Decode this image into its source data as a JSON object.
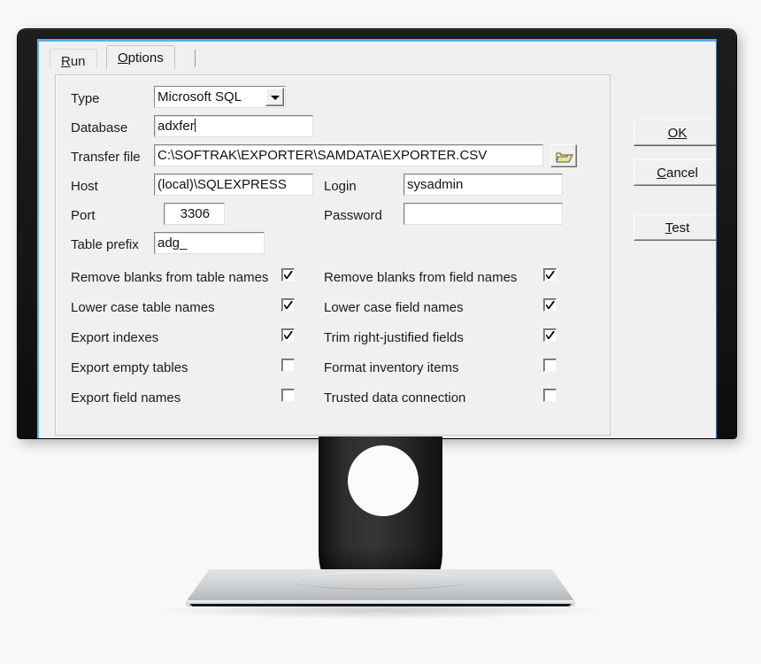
{
  "window": {
    "tabs": [
      {
        "label": "Run",
        "accel": "R",
        "active": false
      },
      {
        "label": "Options",
        "accel": "O",
        "active": true
      }
    ]
  },
  "form": {
    "fields": [
      {
        "name": "type",
        "label": "Type",
        "value": "Microsoft SQL",
        "control": "combobox"
      },
      {
        "name": "database",
        "label": "Database",
        "value": "adxfer",
        "control": "textbox",
        "focused": true
      },
      {
        "name": "transfer_file",
        "label": "Transfer file",
        "value": "C:\\SOFTRAK\\EXPORTER\\SAMDATA\\EXPORTER.CSV",
        "control": "textbox"
      },
      {
        "name": "host",
        "label": "Host",
        "value": "(local)\\SQLEXPRESS",
        "control": "textbox"
      },
      {
        "name": "login",
        "label": "Login",
        "value": "sysadmin",
        "control": "textbox"
      },
      {
        "name": "port",
        "label": "Port",
        "value": "3306",
        "control": "textbox",
        "align": "right"
      },
      {
        "name": "password",
        "label": "Password",
        "value": "",
        "control": "password"
      },
      {
        "name": "table_prefix",
        "label": "Table prefix",
        "value": "adg_",
        "control": "textbox"
      }
    ],
    "browse_icon": "open-folder-icon",
    "dropdown_icon": "chevron-down-icon"
  },
  "checkboxes": {
    "left": [
      {
        "name": "remove-blanks-table-names",
        "label": "Remove blanks from table names",
        "checked": true
      },
      {
        "name": "lower-case-table-names",
        "label": "Lower case table names",
        "checked": true
      },
      {
        "name": "export-indexes",
        "label": "Export indexes",
        "checked": true
      },
      {
        "name": "export-empty-tables",
        "label": "Export empty tables",
        "checked": false
      },
      {
        "name": "export-field-names",
        "label": "Export field names",
        "checked": false
      }
    ],
    "right": [
      {
        "name": "remove-blanks-field-names",
        "label": "Remove blanks from field names",
        "checked": true
      },
      {
        "name": "lower-case-field-names",
        "label": "Lower case field names",
        "checked": true
      },
      {
        "name": "trim-right-justified",
        "label": "Trim right-justified fields",
        "checked": true
      },
      {
        "name": "format-inventory-items",
        "label": "Format inventory items",
        "checked": false
      },
      {
        "name": "trusted-data-connection",
        "label": "Trusted data connection",
        "checked": false
      }
    ]
  },
  "buttons": [
    {
      "name": "ok",
      "label": "OK",
      "accel": "O",
      "default": true
    },
    {
      "name": "cancel",
      "label": "Cancel",
      "accel": "C",
      "default": false
    },
    {
      "name": "test",
      "label": "Test",
      "accel": "T",
      "default": false
    }
  ],
  "colors": {
    "screen_border": "#5ab2e8",
    "window_face": "#f0f0f0",
    "bezel": "#171717",
    "base": "#c9cbcd",
    "folder_icon": "#e8e39b"
  }
}
